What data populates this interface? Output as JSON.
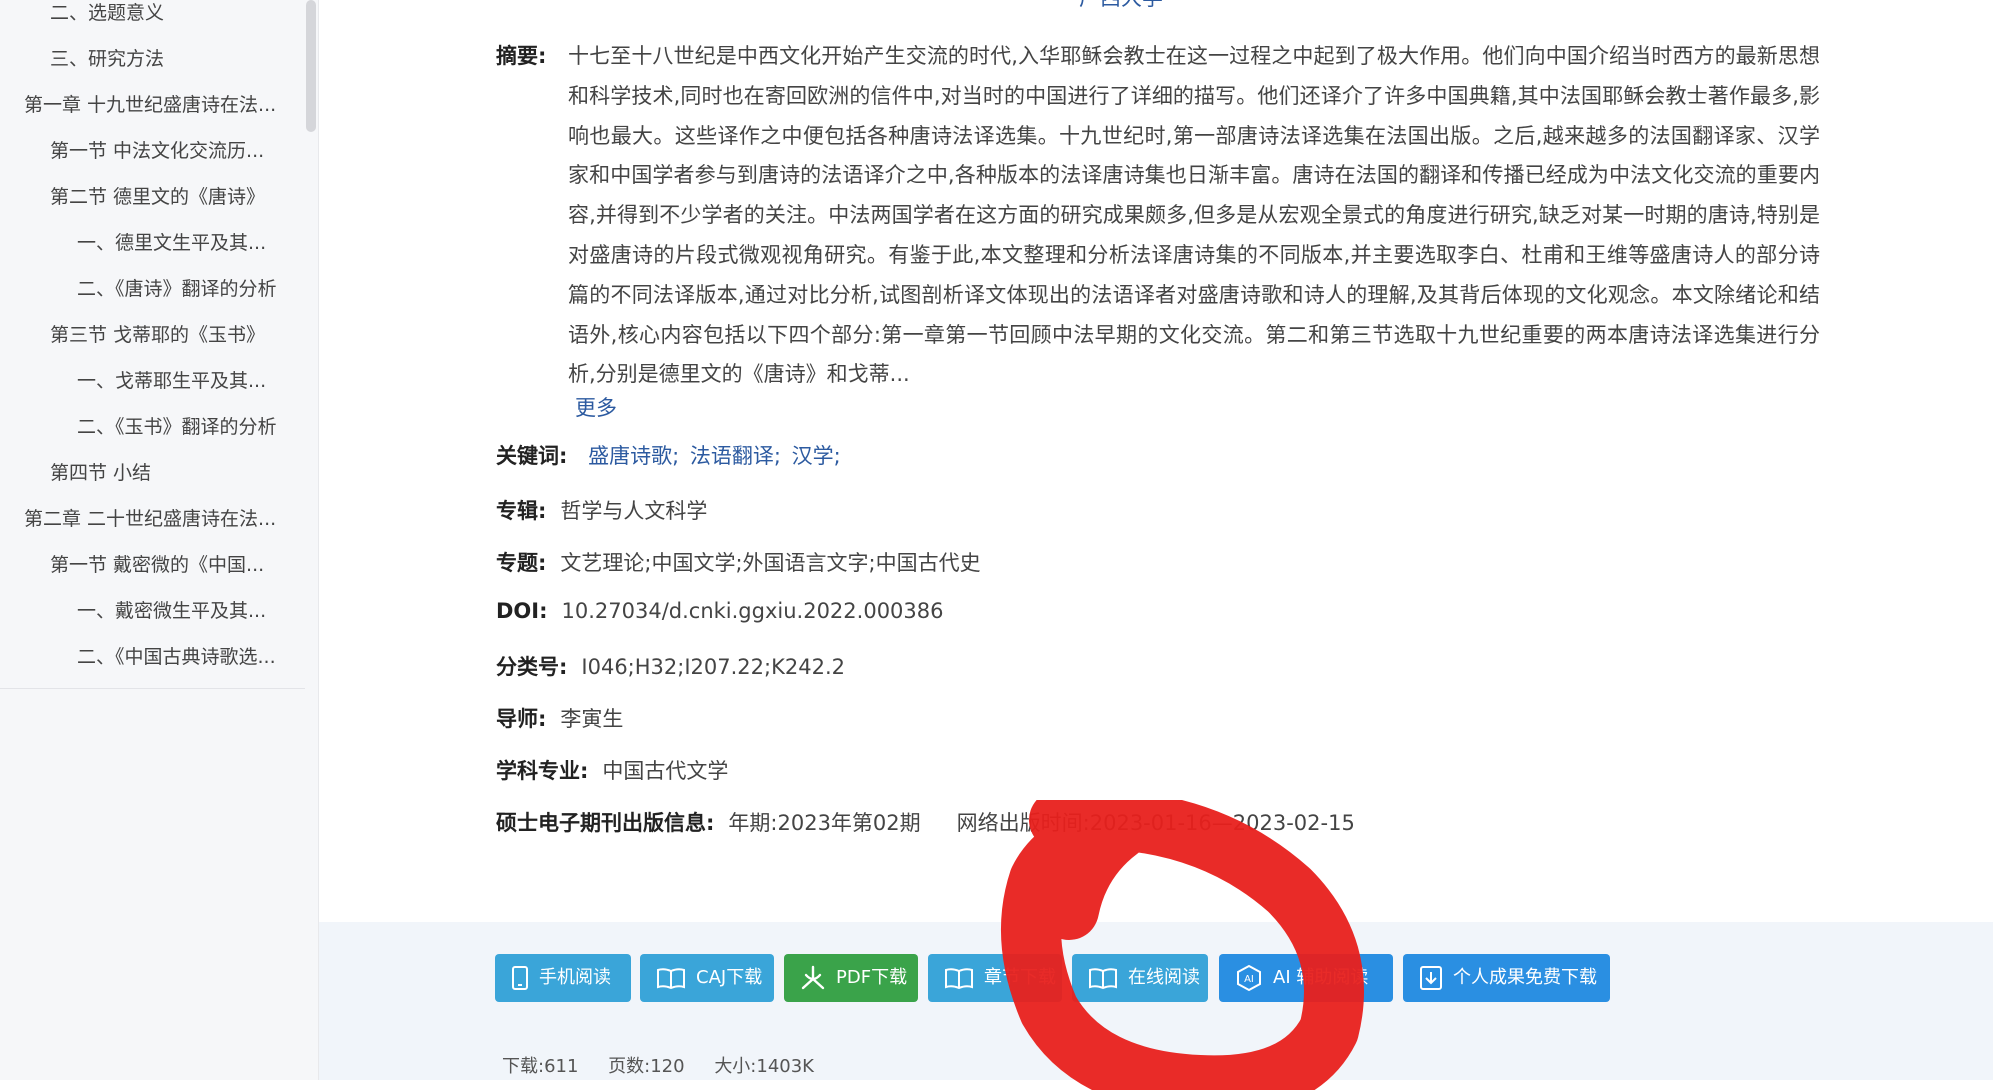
{
  "sidebar": {
    "items": [
      {
        "label": "二、选题意义",
        "level": 1
      },
      {
        "label": "三、研究方法",
        "level": 1
      },
      {
        "label": "第一章 十九世纪盛唐诗在法...",
        "level": 0
      },
      {
        "label": "第一节 中法文化交流历...",
        "level": 1
      },
      {
        "label": "第二节 德里文的《唐诗》",
        "level": 1
      },
      {
        "label": "一、德里文生平及其...",
        "level": 2
      },
      {
        "label": "二、《唐诗》翻译的分析",
        "level": 2
      },
      {
        "label": "第三节 戈蒂耶的《玉书》",
        "level": 1
      },
      {
        "label": "一、戈蒂耶生平及其...",
        "level": 2
      },
      {
        "label": "二、《玉书》翻译的分析",
        "level": 2
      },
      {
        "label": "第四节 小结",
        "level": 1
      },
      {
        "label": "第二章 二十世纪盛唐诗在法...",
        "level": 0
      },
      {
        "label": "第一节 戴密微的《中国...",
        "level": 1
      },
      {
        "label": "一、戴密微生平及其...",
        "level": 2
      },
      {
        "label": "二、《中国古典诗歌选...",
        "level": 2
      }
    ]
  },
  "header": {
    "institution_fragment": "广西大学"
  },
  "abstract": {
    "label": "摘要:",
    "text": "十七至十八世纪是中西文化开始产生交流的时代,入华耶稣会教士在这一过程之中起到了极大作用。他们向中国介绍当时西方的最新思想和科学技术,同时也在寄回欧洲的信件中,对当时的中国进行了详细的描写。他们还译介了许多中国典籍,其中法国耶稣会教士著作最多,影响也最大。这些译作之中便包括各种唐诗法译选集。十九世纪时,第一部唐诗法译选集在法国出版。之后,越来越多的法国翻译家、汉学家和中国学者参与到唐诗的法语译介之中,各种版本的法译唐诗集也日渐丰富。唐诗在法国的翻译和传播已经成为中法文化交流的重要内容,并得到不少学者的关注。中法两国学者在这方面的研究成果颇多,但多是从宏观全景式的角度进行研究,缺乏对某一时期的唐诗,特别是对盛唐诗的片段式微观视角研究。有鉴于此,本文整理和分析法译唐诗集的不同版本,并主要选取李白、杜甫和王维等盛唐诗人的部分诗篇的不同法译版本,通过对比分析,试图剖析译文体现出的法语译者对盛唐诗歌和诗人的理解,及其背后体现的文化观念。本文除绪论和结语外,核心内容包括以下四个部分:第一章第一节回顾中法早期的文化交流。第二和第三节选取十九世纪重要的两本唐诗法译选集进行分析,分别是德里文的《唐诗》和戈蒂...",
    "more": "更多"
  },
  "meta": {
    "keywords_label": "关键词:",
    "keywords": [
      "盛唐诗歌;",
      "法语翻译;",
      "汉学;"
    ],
    "series_label": "专辑:",
    "series": "哲学与人文科学",
    "topic_label": "专题:",
    "topic": "文艺理论;中国文学;外国语言文字;中国古代史",
    "doi_label": "DOI:",
    "doi": "10.27034/d.cnki.ggxiu.2022.000386",
    "class_label": "分类号:",
    "class_no": "I046;H32;I207.22;K242.2",
    "advisor_label": "导师:",
    "advisor": "李寅生",
    "major_label": "学科专业:",
    "major": "中国古代文学",
    "pub_label": "硕士电子期刊出版信息:",
    "pub_year": "年期:2023年第02期",
    "pub_online": "网络出版时间:2023-01-16—2023-02-15"
  },
  "actions": {
    "buttons": [
      {
        "label": "手机阅读",
        "icon": "phone-icon"
      },
      {
        "label": "CAJ下载",
        "icon": "book-icon"
      },
      {
        "label": "PDF下载",
        "icon": "pdf-icon"
      },
      {
        "label": "章节下载",
        "icon": "book-icon"
      },
      {
        "label": "在线阅读",
        "icon": "book-icon"
      },
      {
        "label": "AI 辅助阅读",
        "icon": "ai-icon"
      },
      {
        "label": "个人成果免费下载",
        "icon": "download-icon"
      }
    ],
    "colors": {
      "teal": "#3aa5d9",
      "green": "#3aa34a",
      "blue": "#2a8fe2"
    }
  },
  "stats": {
    "downloads": "下载:611",
    "pages": "页数:120",
    "size": "大小:1403K"
  }
}
